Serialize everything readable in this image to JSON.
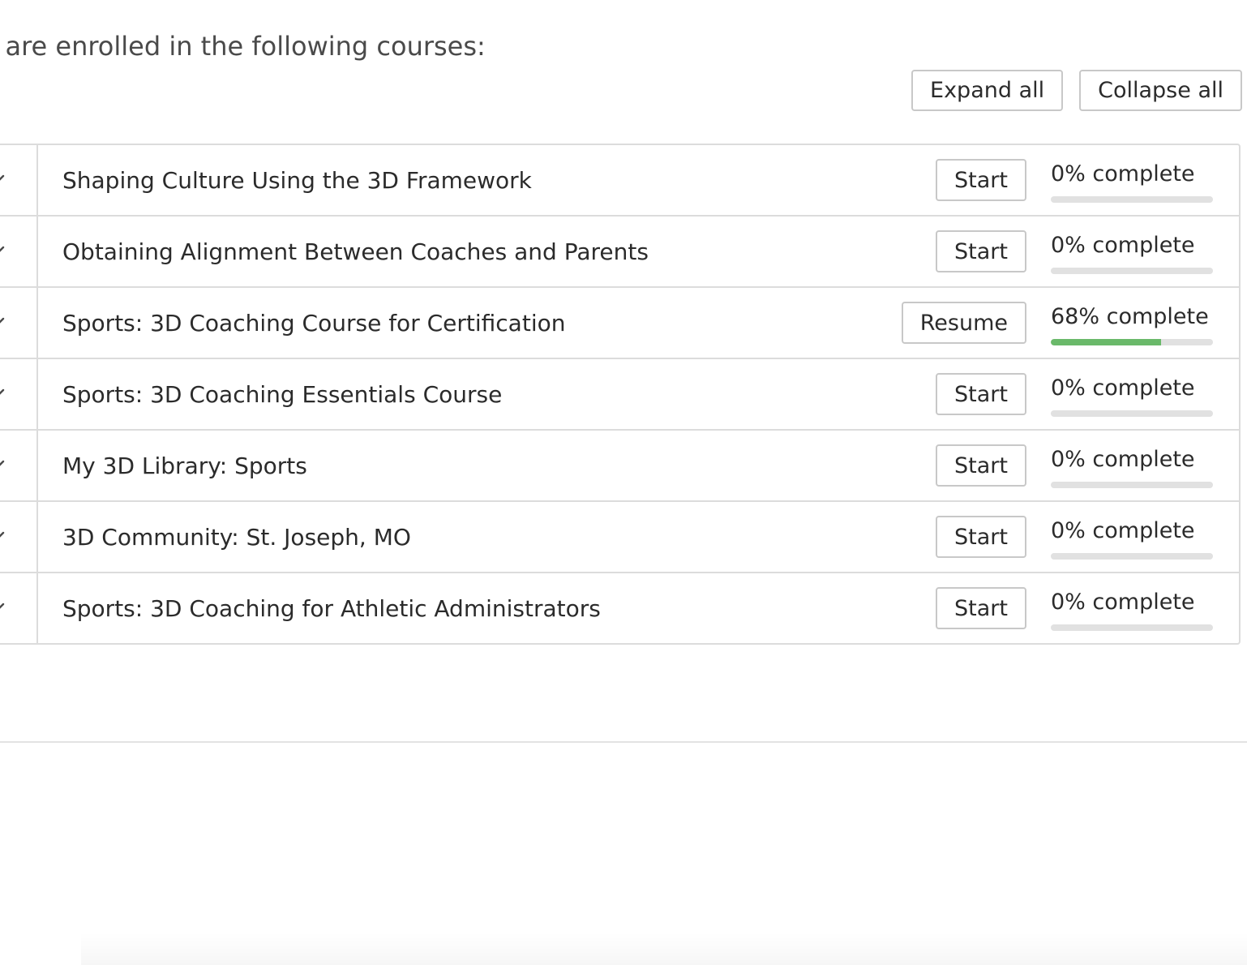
{
  "intro_text": "u are enrolled in the following courses:",
  "toolbar": {
    "expand_all_label": "Expand all",
    "collapse_all_label": "Collapse all"
  },
  "colors": {
    "progress_fill": "#6ab96a",
    "progress_track": "#e1e1e1",
    "border": "#dcdcdc"
  },
  "courses": [
    {
      "title": "Shaping Culture Using the 3D Framework",
      "action": "Start",
      "progress_label": "0% complete",
      "progress_percent": 0,
      "toggle_icon": "chevron-icon"
    },
    {
      "title": "Obtaining Alignment Between Coaches and Parents",
      "action": "Start",
      "progress_label": "0% complete",
      "progress_percent": 0,
      "toggle_icon": "chevron-icon"
    },
    {
      "title": "Sports: 3D Coaching Course for Certification",
      "action": "Resume",
      "progress_label": "68% complete",
      "progress_percent": 68,
      "toggle_icon": "chevron-icon"
    },
    {
      "title": "Sports: 3D Coaching Essentials Course",
      "action": "Start",
      "progress_label": "0% complete",
      "progress_percent": 0,
      "toggle_icon": "chevron-icon"
    },
    {
      "title": "My 3D Library: Sports",
      "action": "Start",
      "progress_label": "0% complete",
      "progress_percent": 0,
      "toggle_icon": "chevron-icon"
    },
    {
      "title": "3D Community: St. Joseph, MO",
      "action": "Start",
      "progress_label": "0% complete",
      "progress_percent": 0,
      "toggle_icon": "chevron-icon"
    },
    {
      "title": "Sports: 3D Coaching for Athletic Administrators",
      "action": "Start",
      "progress_label": "0% complete",
      "progress_percent": 0,
      "toggle_icon": "chevron-icon"
    }
  ]
}
